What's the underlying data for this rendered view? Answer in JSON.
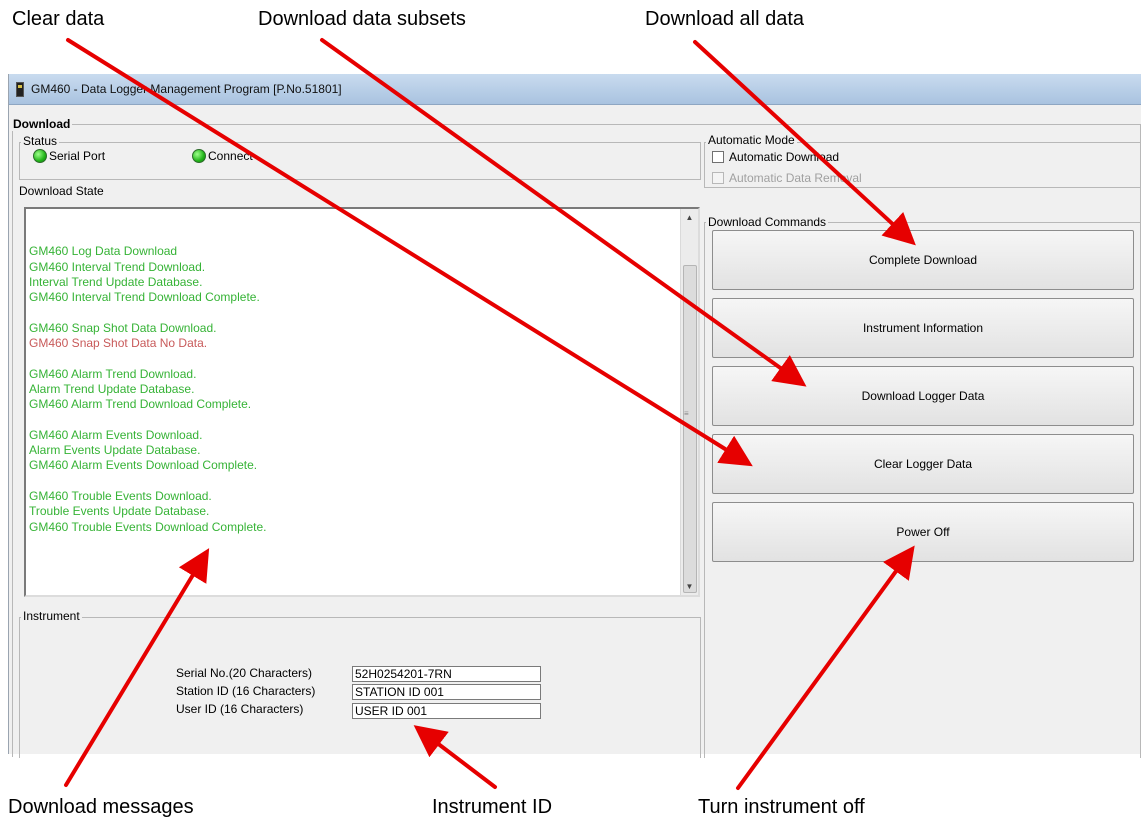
{
  "callouts": {
    "clear_data": "Clear data",
    "download_subsets": "Download data subsets",
    "download_all": "Download all data",
    "download_messages": "Download messages",
    "instrument_id": "Instrument ID",
    "turn_off": "Turn instrument off"
  },
  "window": {
    "title": "GM460 - Data Logger Management Program [P.No.51801]"
  },
  "download_group": {
    "legend": "Download"
  },
  "status": {
    "legend": "Status",
    "serial_port": "Serial Port",
    "connect": "Connect",
    "led_color": "#22b51a"
  },
  "automatic_mode": {
    "legend": "Automatic Mode",
    "automatic_download": "Automatic Download",
    "automatic_data_removal": "Automatic Data Removal"
  },
  "download_state": {
    "label": "Download State",
    "lines": [
      {
        "text": "",
        "color": "green"
      },
      {
        "text": "GM460 Log Data Download",
        "color": "green"
      },
      {
        "text": "GM460 Interval Trend Download.",
        "color": "green"
      },
      {
        "text": "Interval Trend Update Database.",
        "color": "green"
      },
      {
        "text": "GM460 Interval Trend Download Complete.",
        "color": "green"
      },
      {
        "text": "",
        "color": "green"
      },
      {
        "text": "GM460 Snap Shot Data Download.",
        "color": "green"
      },
      {
        "text": "GM460 Snap Shot Data No Data.",
        "color": "red"
      },
      {
        "text": "",
        "color": "green"
      },
      {
        "text": "GM460 Alarm Trend Download.",
        "color": "green"
      },
      {
        "text": "Alarm Trend Update Database.",
        "color": "green"
      },
      {
        "text": "GM460 Alarm Trend Download Complete.",
        "color": "green"
      },
      {
        "text": "",
        "color": "green"
      },
      {
        "text": "GM460 Alarm Events Download.",
        "color": "green"
      },
      {
        "text": "Alarm Events Update Database.",
        "color": "green"
      },
      {
        "text": "GM460 Alarm Events Download Complete.",
        "color": "green"
      },
      {
        "text": "",
        "color": "green"
      },
      {
        "text": "GM460 Trouble Events Download.",
        "color": "green"
      },
      {
        "text": "Trouble Events Update Database.",
        "color": "green"
      },
      {
        "text": "GM460 Trouble Events Download Complete.",
        "color": "green"
      }
    ]
  },
  "download_commands": {
    "legend": "Download Commands",
    "complete_download": "Complete Download",
    "instrument_information": "Instrument Information",
    "download_logger_data": "Download Logger Data",
    "clear_logger_data": "Clear Logger Data",
    "power_off": "Power Off"
  },
  "instrument": {
    "legend": "Instrument",
    "serial_label": "Serial No.(20 Characters)",
    "serial_value": "52H0254201-7RN",
    "station_label": "Station ID (16 Characters)",
    "station_value": "STATION  ID  001",
    "user_label": "User ID (16 Characters)",
    "user_value": "USER  ID  001"
  },
  "colors": {
    "log_green": "#36b336",
    "log_red": "#c85a5a",
    "arrow_red": "#e60000"
  }
}
